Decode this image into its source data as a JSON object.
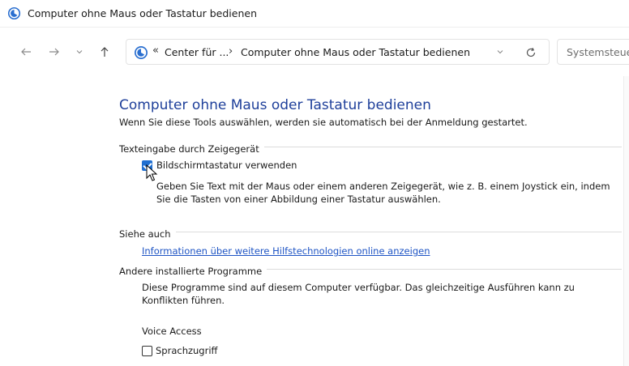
{
  "window": {
    "title": "Computer ohne Maus oder Tastatur bedienen",
    "title_icon": "ease-of-access-icon"
  },
  "nav": {
    "back_icon": "arrow-left-icon",
    "forward_icon": "arrow-right-icon",
    "recent_icon": "chevron-down-icon",
    "up_icon": "arrow-up-icon",
    "address": {
      "overflow": "«",
      "crumb_parent": "Center für ...",
      "separator": "›",
      "crumb_current": "Computer ohne Maus oder Tastatur bedienen",
      "dropdown_icon": "chevron-down-icon",
      "refresh_icon": "refresh-icon"
    },
    "search": {
      "placeholder": "Systemsteuerung durchsuchen"
    }
  },
  "main": {
    "title": "Computer ohne Maus oder Tastatur bedienen",
    "subtitle": "Wenn Sie diese Tools auswählen, werden sie automatisch bei der Anmeldung gestartet.",
    "section_pointer": {
      "heading": "Texteingabe durch Zeigegerät",
      "option_label": "Bildschirmtastatur verwenden",
      "option_checked": true,
      "description": "Geben Sie Text mit der Maus oder einem anderen Zeigegerät, wie z. B. einem Joystick ein, indem Sie die Tasten von einer Abbildung einer Tastatur auswählen."
    },
    "section_see_also": {
      "heading": "Siehe auch",
      "link": "Informationen über weitere Hilfstechnologien online anzeigen"
    },
    "section_other": {
      "heading": "Andere installierte Programme",
      "description": "Diese Programme sind auf diesem Computer verfügbar. Das gleichzeitige Ausführen kann zu Konflikten führen.",
      "program_name": "Voice Access",
      "option_label": "Sprachzugriff",
      "option_checked": false
    }
  },
  "colors": {
    "title_blue": "#1e3f9a",
    "link_blue": "#1e54c4",
    "checkbox_blue": "#1f6fd1"
  }
}
